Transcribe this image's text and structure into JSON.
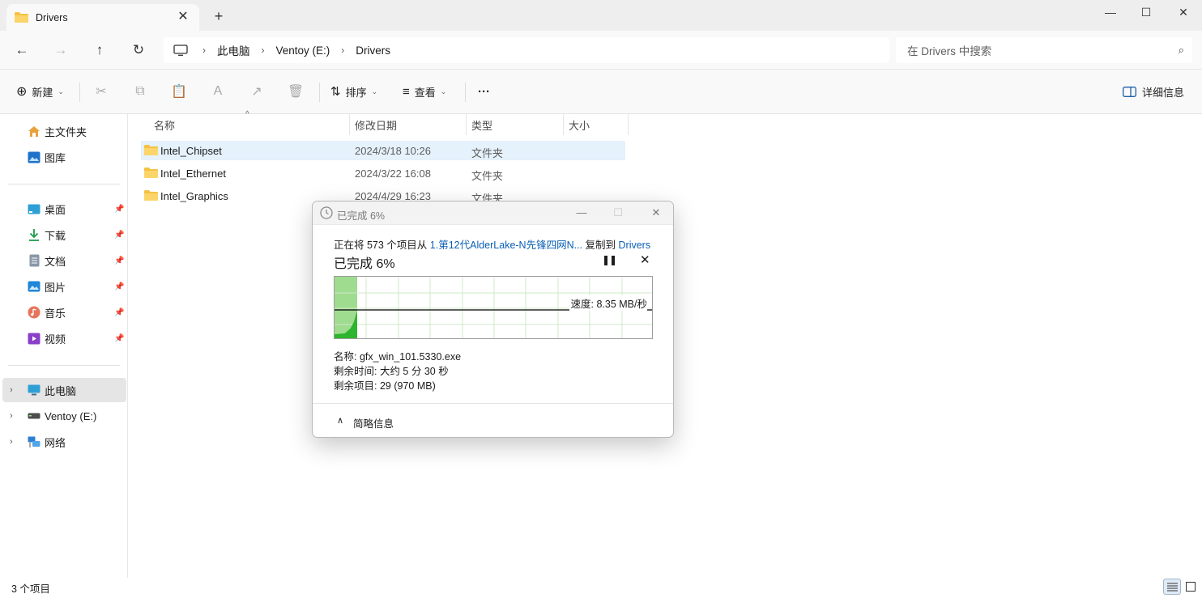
{
  "window": {
    "tab_title": "Drivers",
    "tab_close_icon": "✕",
    "new_tab_icon": "+",
    "minimize_icon": "—",
    "maximize_icon": "☐",
    "close_icon": "✕"
  },
  "nav": {
    "back_icon": "←",
    "forward_icon": "→",
    "up_icon": "↑",
    "refresh_icon": "↻",
    "breadcrumb": [
      "此电脑",
      "Ventoy (E:)",
      "Drivers"
    ],
    "separator": "›",
    "search_placeholder": "在 Drivers 中搜索",
    "search_icon": "⌕"
  },
  "toolbar": {
    "new_label": "新建",
    "sort_label": "排序",
    "view_label": "查看",
    "more_label": "···",
    "details_label": "详细信息",
    "caret": "⌄",
    "icons": {
      "cut": "✂",
      "copy": "⧉",
      "paste": "📋",
      "rename": "A",
      "share": "↗",
      "delete": "🗑",
      "new": "⊕",
      "sort": "⇅",
      "view": "≡"
    }
  },
  "sidebar": {
    "home": "主文件夹",
    "gallery": "图库",
    "quick_access": [
      {
        "label": "桌面",
        "icon": "desktop-icon"
      },
      {
        "label": "下载",
        "icon": "download-icon"
      },
      {
        "label": "文档",
        "icon": "documents-icon"
      },
      {
        "label": "图片",
        "icon": "pictures-icon"
      },
      {
        "label": "音乐",
        "icon": "music-icon"
      },
      {
        "label": "视频",
        "icon": "videos-icon"
      }
    ],
    "pin_icon": "📌",
    "this_pc": "此电脑",
    "ventoy": "Ventoy (E:)",
    "network": "网络",
    "chevron": "›"
  },
  "file_list": {
    "columns": [
      "名称",
      "修改日期",
      "类型",
      "大小"
    ],
    "sort_caret": "^",
    "rows": [
      {
        "name": "Intel_Chipset",
        "date": "2024/3/18 10:26",
        "type": "文件夹"
      },
      {
        "name": "Intel_Ethernet",
        "date": "2024/3/22 16:08",
        "type": "文件夹"
      },
      {
        "name": "Intel_Graphics",
        "date": "2024/4/29 16:23",
        "type": "文件夹"
      }
    ]
  },
  "status": {
    "item_count": "3 个项目"
  },
  "copy_dialog": {
    "title": "已完成 6%",
    "line_prefix": "正在将 573 个项目从 ",
    "source": "1.第12代AlderLake-N先锋四网N...",
    "line_mid": " 复制到 ",
    "destination": "Drivers",
    "percent_text": "已完成 6%",
    "pause_icon": "❚❚",
    "cancel_icon": "✕",
    "progress_fraction": 0.06,
    "speed": "速度: 8.35 MB/秒",
    "name": "名称: gfx_win_101.5330.exe",
    "time_left": "剩余时间: 大约 5 分 30 秒",
    "items_left": "剩余项目: 29 (970 MB)",
    "less_details": "简略信息",
    "less_details_icon": "∧",
    "colors": {
      "fill": "#9fdc8f",
      "curve": "#2db52d",
      "grid": "#cfe9c9",
      "line": "#000000"
    }
  }
}
